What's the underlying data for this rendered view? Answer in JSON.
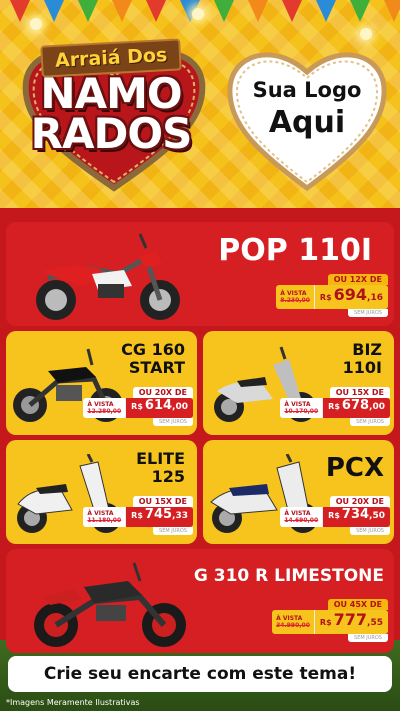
{
  "header": {
    "title_small": "Arraiá Dos",
    "title_big_1": "NAMO",
    "title_big_2": "RADOS",
    "logo_line1": "Sua Logo",
    "logo_line2": "Aqui"
  },
  "products": [
    {
      "name": "POP 110I",
      "installments": "OU 12X DE",
      "avista_label": "À VISTA",
      "old_price": "8.230,00",
      "currency": "R$",
      "price": "694",
      "cents": ",16",
      "sem_juros": "SEM JUROS"
    },
    {
      "name_1": "CG 160",
      "name_2": "START",
      "installments": "OU 20X DE",
      "avista_label": "À VISTA",
      "old_price": "12.280,00",
      "currency": "R$",
      "price": "614",
      "cents": ",00",
      "sem_juros": "SEM JUROS"
    },
    {
      "name_1": "BIZ",
      "name_2": "110I",
      "installments": "OU 15X DE",
      "avista_label": "À VISTA",
      "old_price": "10.170,00",
      "currency": "R$",
      "price": "678",
      "cents": ",00",
      "sem_juros": "SEM JUROS"
    },
    {
      "name_1": "ELITE",
      "name_2": "125",
      "installments": "OU 15X DE",
      "avista_label": "À VISTA",
      "old_price": "11.180,00",
      "currency": "R$",
      "price": "745",
      "cents": ",33",
      "sem_juros": "SEM JUROS"
    },
    {
      "name": "PCX",
      "installments": "OU 20X DE",
      "avista_label": "À VISTA",
      "old_price": "14.690,00",
      "currency": "R$",
      "price": "734",
      "cents": ",50",
      "sem_juros": "SEM JUROS"
    },
    {
      "name": "G 310 R LIMESTONE",
      "installments": "OU 45X DE",
      "avista_label": "À VISTA",
      "old_price": "34.990,00",
      "currency": "R$",
      "price": "777",
      "cents": ",55",
      "sem_juros": "SEM JUROS"
    }
  ],
  "footer": {
    "cta": "Crie seu encarte com este tema!",
    "disclaimer": "*Imagens Meramente Ilustrativas"
  },
  "colors": {
    "red": "#d61f22",
    "yellow": "#f7c41e",
    "background": "#c4181c"
  }
}
